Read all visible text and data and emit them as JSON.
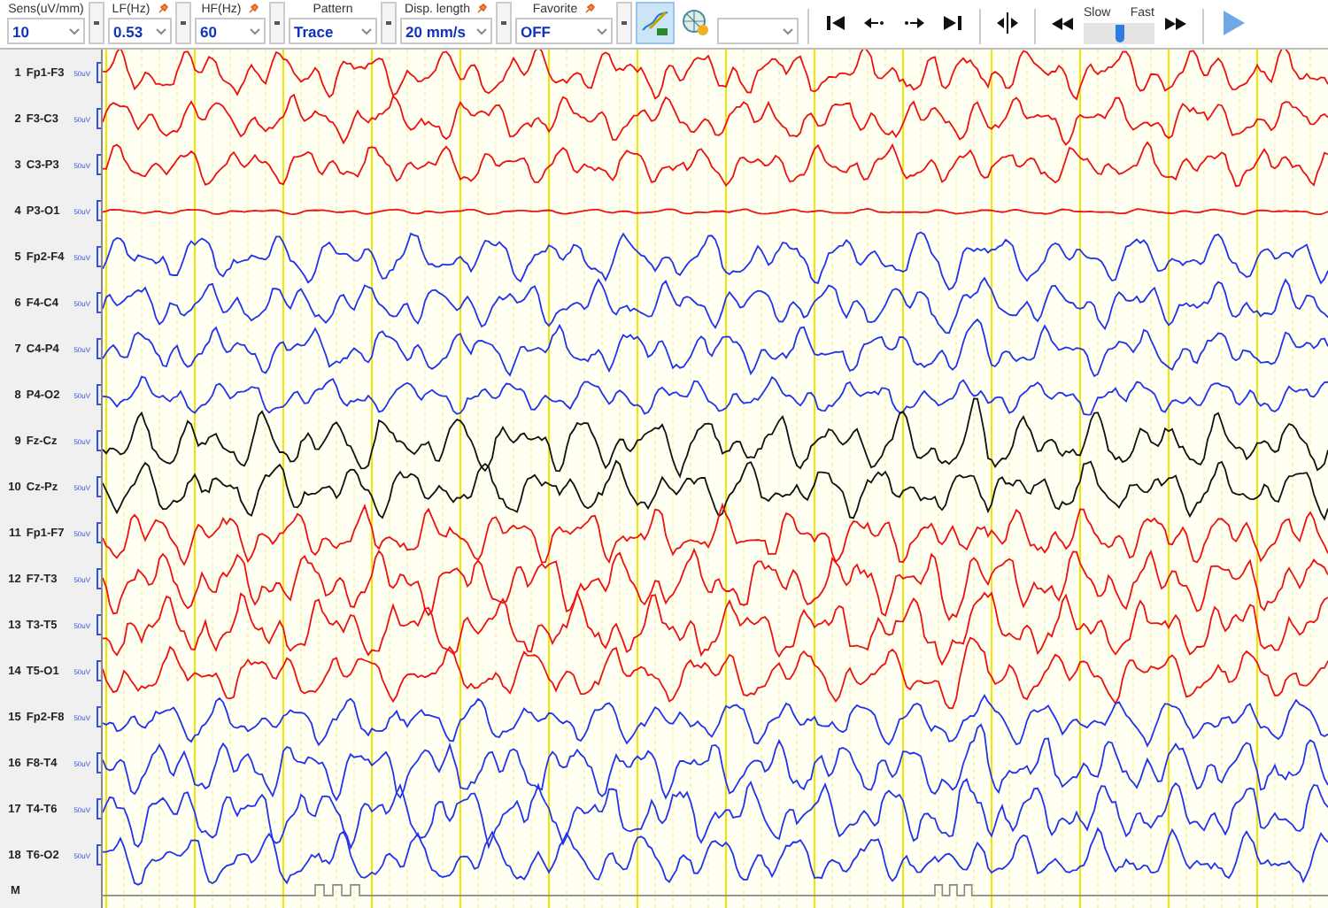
{
  "toolbar": {
    "fields": [
      {
        "label": "Sens(uV/mm)",
        "value": "10",
        "pinned": false
      },
      {
        "label": "LF(Hz)",
        "value": "0.53",
        "pinned": true
      },
      {
        "label": "HF(Hz)",
        "value": "60",
        "pinned": true
      },
      {
        "label": "Pattern",
        "value": "Trace",
        "pinned": false
      },
      {
        "label": "Disp. length",
        "value": "20 mm/s",
        "pinned": true
      },
      {
        "label": "Favorite",
        "value": "OFF",
        "pinned": true
      }
    ],
    "speed": {
      "slow_label": "Slow",
      "fast_label": "Fast",
      "level": 0.5
    }
  },
  "channels": [
    {
      "number": "1",
      "name": "Fp1-F3",
      "scale": "50uV",
      "color": "#ee1111"
    },
    {
      "number": "2",
      "name": "F3-C3",
      "scale": "50uV",
      "color": "#ee1111"
    },
    {
      "number": "3",
      "name": "C3-P3",
      "scale": "50uV",
      "color": "#ee1111"
    },
    {
      "number": "4",
      "name": "P3-O1",
      "scale": "50uV",
      "color": "#ee1111"
    },
    {
      "number": "5",
      "name": "Fp2-F4",
      "scale": "50uV",
      "color": "#2233ee"
    },
    {
      "number": "6",
      "name": "F4-C4",
      "scale": "50uV",
      "color": "#2233ee"
    },
    {
      "number": "7",
      "name": "C4-P4",
      "scale": "50uV",
      "color": "#2233ee"
    },
    {
      "number": "8",
      "name": "P4-O2",
      "scale": "50uV",
      "color": "#2233ee"
    },
    {
      "number": "9",
      "name": "Fz-Cz",
      "scale": "50uV",
      "color": "#111111"
    },
    {
      "number": "10",
      "name": "Cz-Pz",
      "scale": "50uV",
      "color": "#111111"
    },
    {
      "number": "11",
      "name": "Fp1-F7",
      "scale": "50uV",
      "color": "#ee1111"
    },
    {
      "number": "12",
      "name": "F7-T3",
      "scale": "50uV",
      "color": "#ee1111"
    },
    {
      "number": "13",
      "name": "T3-T5",
      "scale": "50uV",
      "color": "#ee1111"
    },
    {
      "number": "14",
      "name": "T5-O1",
      "scale": "50uV",
      "color": "#ee1111"
    },
    {
      "number": "15",
      "name": "Fp2-F8",
      "scale": "50uV",
      "color": "#2233ee"
    },
    {
      "number": "16",
      "name": "F8-T4",
      "scale": "50uV",
      "color": "#2233ee"
    },
    {
      "number": "17",
      "name": "T4-T6",
      "scale": "50uV",
      "color": "#2233ee"
    },
    {
      "number": "18",
      "name": "T6-O2",
      "scale": "50uV",
      "color": "#2233ee"
    }
  ],
  "marker": {
    "label": "M"
  }
}
